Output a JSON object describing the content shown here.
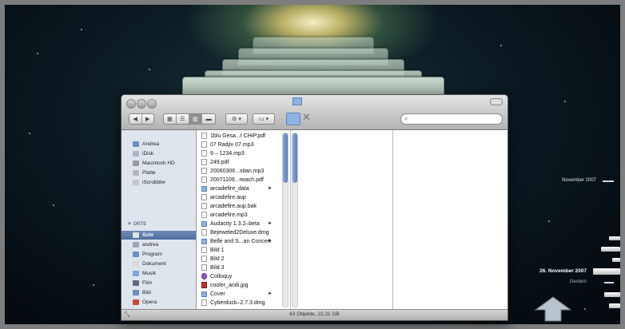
{
  "window": {
    "search_placeholder": "",
    "status": "63 Objekte, 22,31 GB"
  },
  "sidebar": {
    "devices": [
      {
        "label": "Andrea",
        "icon": "computer-icon"
      },
      {
        "label": "iDisk",
        "icon": "idisk-icon"
      },
      {
        "label": "Macintosh HD",
        "icon": "hard-drive-icon"
      },
      {
        "label": "Platte",
        "icon": "disk-icon"
      },
      {
        "label": "iScrobbler",
        "icon": "disk-icon"
      }
    ],
    "places_header": "▼ ORTE",
    "places": [
      {
        "label": "Schr",
        "icon": "desktop-icon",
        "selected": true
      },
      {
        "label": "andrea",
        "icon": "home-icon"
      },
      {
        "label": "Program",
        "icon": "applications-icon"
      },
      {
        "label": "Dokument",
        "icon": "documents-icon"
      },
      {
        "label": "Musik",
        "icon": "music-icon"
      },
      {
        "label": "Film",
        "icon": "movies-icon"
      },
      {
        "label": "Bild",
        "icon": "pictures-icon"
      },
      {
        "label": "Opera",
        "icon": "opera-icon"
      }
    ]
  },
  "files": [
    {
      "name": "1blu Gesa...t CHIP.pdf",
      "kind": "doc"
    },
    {
      "name": "07 Radjiv 07.mp3",
      "kind": "doc"
    },
    {
      "name": "9 – 1234.mp3",
      "kind": "doc"
    },
    {
      "name": "249.pdf",
      "kind": "doc"
    },
    {
      "name": "20060306...stian.mp3",
      "kind": "doc"
    },
    {
      "name": "20071109...rwach.pdf",
      "kind": "doc"
    },
    {
      "name": "arcadefire_data",
      "kind": "folder",
      "arrow": "►"
    },
    {
      "name": "arcadefire.aup",
      "kind": "doc"
    },
    {
      "name": "arcadefire.aup.bak",
      "kind": "doc"
    },
    {
      "name": "arcadefire.mp3",
      "kind": "doc"
    },
    {
      "name": "Audacity 1.3.2–beta",
      "kind": "folder",
      "arrow": "►"
    },
    {
      "name": "Bejeweled2Deluxe.dmg",
      "kind": "doc"
    },
    {
      "name": "Belle and S...an Concert",
      "kind": "folder",
      "arrow": "►"
    },
    {
      "name": "Bild 1",
      "kind": "doc"
    },
    {
      "name": "Bild 2",
      "kind": "doc"
    },
    {
      "name": "Bild 3",
      "kind": "doc"
    },
    {
      "name": "Colloquy",
      "kind": "purple"
    },
    {
      "name": "cooler_andi.jpg",
      "kind": "red"
    },
    {
      "name": "Cover",
      "kind": "folder",
      "arrow": "►"
    },
    {
      "name": "Cyberduck–2.7.3.dmg",
      "kind": "doc"
    }
  ],
  "timeline": {
    "upper_label": "November 2007",
    "current_label": "26. November 2007",
    "lower_label": "Gestern"
  },
  "colors": {
    "selection": "#5677a8",
    "sidebar_bg": "#dfe5ed"
  }
}
